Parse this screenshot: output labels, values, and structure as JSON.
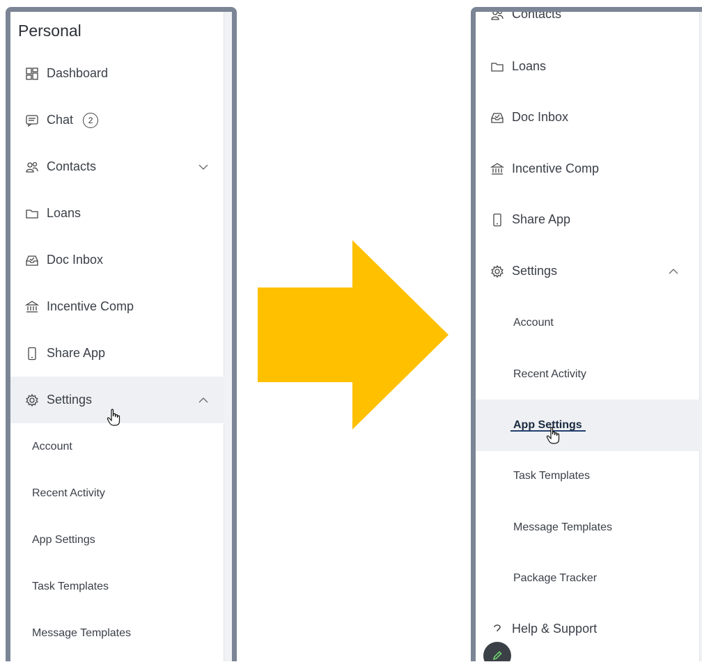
{
  "left_panel": {
    "section_title": "Personal",
    "items": [
      {
        "label": "Dashboard",
        "icon": "dashboard-icon"
      },
      {
        "label": "Chat",
        "icon": "chat-icon",
        "badge": "2"
      },
      {
        "label": "Contacts",
        "icon": "contacts-icon",
        "chevron": "down"
      },
      {
        "label": "Loans",
        "icon": "folder-icon"
      },
      {
        "label": "Doc Inbox",
        "icon": "inbox-icon"
      },
      {
        "label": "Incentive Comp",
        "icon": "bank-icon"
      },
      {
        "label": "Share App",
        "icon": "phone-icon"
      },
      {
        "label": "Settings",
        "icon": "gear-icon",
        "chevron": "up",
        "hovered": true
      }
    ],
    "sub_items": [
      "Account",
      "Recent Activity",
      "App Settings",
      "Task Templates",
      "Message Templates"
    ]
  },
  "right_panel": {
    "partial_top_item": "Contacts",
    "items": [
      {
        "label": "Loans",
        "icon": "folder-icon"
      },
      {
        "label": "Doc Inbox",
        "icon": "inbox-icon"
      },
      {
        "label": "Incentive Comp",
        "icon": "bank-icon"
      },
      {
        "label": "Share App",
        "icon": "phone-icon"
      },
      {
        "label": "Settings",
        "icon": "gear-icon",
        "chevron": "up"
      }
    ],
    "sub_items": [
      "Account",
      "Recent Activity",
      "App Settings",
      "Task Templates",
      "Message Templates",
      "Package Tracker"
    ],
    "active_sub_item": "App Settings",
    "bottom_item": {
      "label": "Help & Support",
      "icon": "help-icon"
    }
  },
  "colors": {
    "arrow": "#FFC000",
    "panel_border": "#7b8595",
    "active_underline": "#23406e"
  }
}
